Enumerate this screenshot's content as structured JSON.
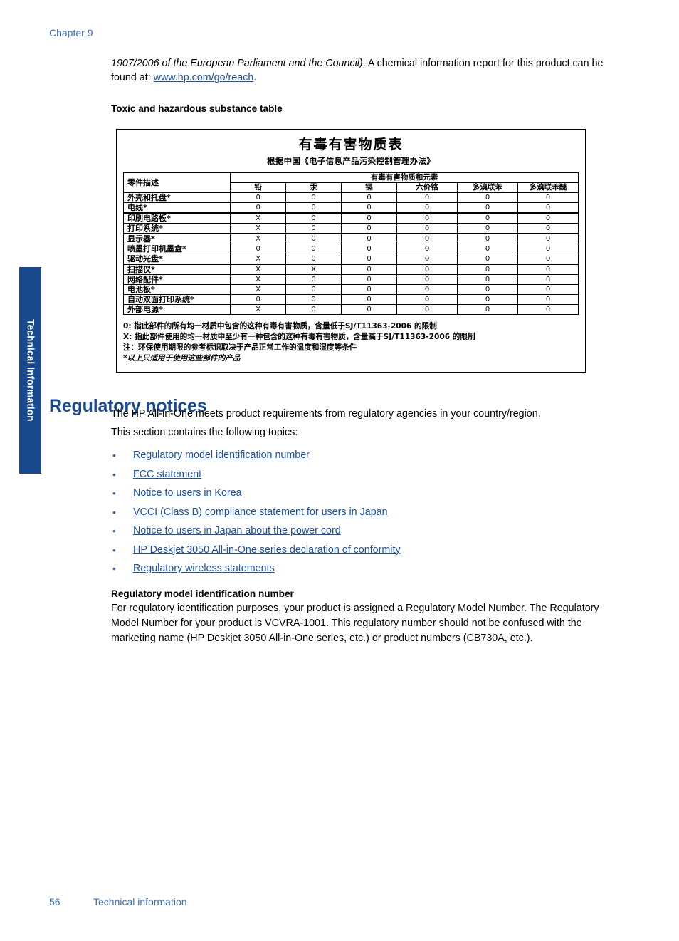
{
  "page": {
    "chapter_label": "Chapter 9",
    "side_tab_label": "Technical information",
    "footer_page_number": "56",
    "footer_section": "Technical information",
    "accent_blue": "#1A4A8E",
    "link_blue": "#1F4FA0",
    "header_blue": "#3E6DB5"
  },
  "intro": {
    "italic_part": "1907/2006 of the European Parliament and the Council)",
    "text_after_italic": ". A chemical information report for this product can be found at: ",
    "link_text": "www.hp.com/go/reach",
    "text_end": ".",
    "table_heading": "Toxic and hazardous substance table"
  },
  "substance_table": {
    "title": "有毒有害物质表",
    "subtitle": "根据中国《电子信息产品污染控制管理办法》",
    "group_header": "有毒有害物质和元素",
    "desc_header": "零件描述",
    "columns": [
      "铅",
      "汞",
      "镉",
      "六价铬",
      "多溴联苯",
      "多溴联苯醚"
    ],
    "rows": [
      {
        "name": "外壳和托盘*",
        "values": [
          "0",
          "0",
          "0",
          "0",
          "0",
          "0"
        ]
      },
      {
        "name": "电线*",
        "values": [
          "0",
          "0",
          "0",
          "0",
          "0",
          "0"
        ]
      },
      {
        "name": "印刷电路板*",
        "values": [
          "X",
          "0",
          "0",
          "0",
          "0",
          "0"
        ]
      },
      {
        "name": "打印系统*",
        "values": [
          "X",
          "0",
          "0",
          "0",
          "0",
          "0"
        ]
      },
      {
        "name": "显示器*",
        "values": [
          "X",
          "0",
          "0",
          "0",
          "0",
          "0"
        ]
      },
      {
        "name": "喷墨打印机墨盒*",
        "values": [
          "0",
          "0",
          "0",
          "0",
          "0",
          "0"
        ]
      },
      {
        "name": "驱动光盘*",
        "values": [
          "X",
          "0",
          "0",
          "0",
          "0",
          "0"
        ]
      },
      {
        "name": "扫描仪*",
        "values": [
          "X",
          "X",
          "0",
          "0",
          "0",
          "0"
        ]
      },
      {
        "name": "网络配件*",
        "values": [
          "X",
          "0",
          "0",
          "0",
          "0",
          "0"
        ]
      },
      {
        "name": "电池板*",
        "values": [
          "X",
          "0",
          "0",
          "0",
          "0",
          "0"
        ]
      },
      {
        "name": "自动双面打印系统*",
        "values": [
          "0",
          "0",
          "0",
          "0",
          "0",
          "0"
        ]
      },
      {
        "name": "外部电源*",
        "values": [
          "X",
          "0",
          "0",
          "0",
          "0",
          "0"
        ]
      }
    ],
    "notes": [
      "0: 指此部件的所有均一材质中包含的这种有毒有害物质，含量低于SJ/T11363-2006 的限制",
      "X: 指此部件使用的均一材质中至少有一种包含的这种有毒有害物质，含量高于SJ/T11363-2006 的限制",
      "注：环保使用期限的参考标识取决于产品正常工作的温度和湿度等条件",
      "*以上只适用于使用这些部件的产品"
    ]
  },
  "regulatory": {
    "heading": "Regulatory notices",
    "intro_line1": "The HP All-in-One meets product requirements from regulatory agencies in your country/region.",
    "intro_line2": "This section contains the following topics:",
    "links": [
      "Regulatory model identification number",
      "FCC statement",
      "Notice to users in Korea",
      "VCCI (Class B) compliance statement for users in Japan",
      "Notice to users in Japan about the power cord",
      "HP Deskjet 3050 All-in-One series declaration of conformity",
      "Regulatory wireless statements"
    ],
    "bullet_glyph": "•",
    "model_heading": "Regulatory model identification number",
    "model_body": "For regulatory identification purposes, your product is assigned a Regulatory Model Number. The Regulatory Model Number for your product is VCVRA-1001. This regulatory number should not be confused with the marketing name (HP Deskjet 3050 All-in-One series, etc.) or product numbers (CB730A, etc.)."
  }
}
